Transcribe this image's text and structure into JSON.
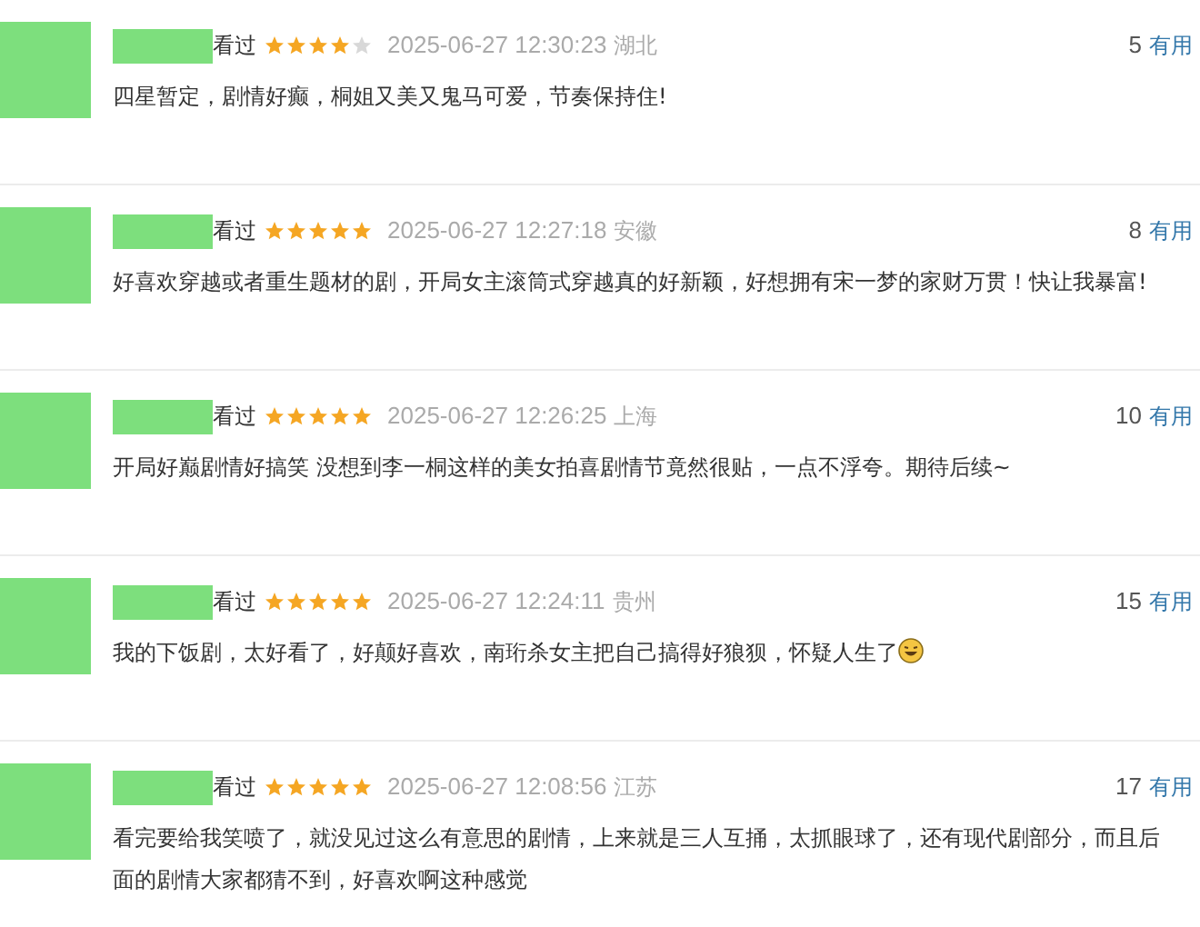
{
  "comments": [
    {
      "status": "看过",
      "stars": 4,
      "time": "2025-06-27 12:30:23",
      "location": "湖北",
      "votes": "5",
      "vote_label": "有用",
      "text": "四星暂定，剧情好癫，桐姐又美又鬼马可爱，节奏保持住!"
    },
    {
      "status": "看过",
      "stars": 5,
      "time": "2025-06-27 12:27:18",
      "location": "安徽",
      "votes": "8",
      "vote_label": "有用",
      "text": "好喜欢穿越或者重生题材的剧，开局女主滚筒式穿越真的好新颖，好想拥有宋一梦的家财万贯！快让我暴富!"
    },
    {
      "status": "看过",
      "stars": 5,
      "time": "2025-06-27 12:26:25",
      "location": "上海",
      "votes": "10",
      "vote_label": "有用",
      "text": "开局好巅剧情好搞笑 没想到李一桐这样的美女拍喜剧情节竟然很贴，一点不浮夸。期待后续~"
    },
    {
      "status": "看过",
      "stars": 5,
      "time": "2025-06-27 12:24:11",
      "location": "贵州",
      "votes": "15",
      "vote_label": "有用",
      "text": "我的下饭剧，太好看了，好颠好喜欢，南珩杀女主把自己搞得好狼狈，怀疑人生了",
      "trailing_emoji": true
    },
    {
      "status": "看过",
      "stars": 5,
      "time": "2025-06-27 12:08:56",
      "location": "江苏",
      "votes": "17",
      "vote_label": "有用",
      "text": "看完要给我笑喷了，就没见过这么有意思的剧情，上来就是三人互捅，太抓眼球了，还有现代剧部分，而且后面的剧情大家都猜不到，好喜欢啊这种感觉"
    }
  ]
}
